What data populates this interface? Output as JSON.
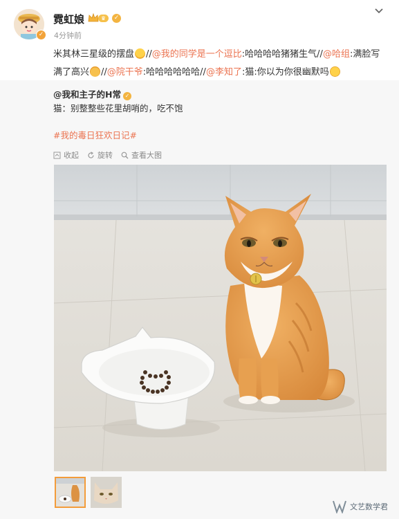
{
  "header": {
    "username": "霓虹娘",
    "time": "4分钟前"
  },
  "post": {
    "p1": "米其林三星级的摆盘",
    "p2": "//",
    "m1": "@我的同学是一个逗比",
    "p3": ":哈哈哈哈猪猪生气//",
    "m2": "@哈组",
    "p4": ":满脸写满了高兴",
    "p5": "//",
    "m3": "@院干爷",
    "p6": ":哈哈哈哈哈哈//",
    "m4": "@李知了",
    "p7": ":猫:你以为你很幽默吗"
  },
  "repost": {
    "author": "@我和主子的H常",
    "text": "猫：别整整些花里胡哨的，吃不饱",
    "topic": "#我的毒日狂欢日记#"
  },
  "actions": {
    "collect": "收起",
    "rotate": "旋转",
    "view_large": "查看大图"
  },
  "watermark": {
    "text": "文艺数学君"
  }
}
